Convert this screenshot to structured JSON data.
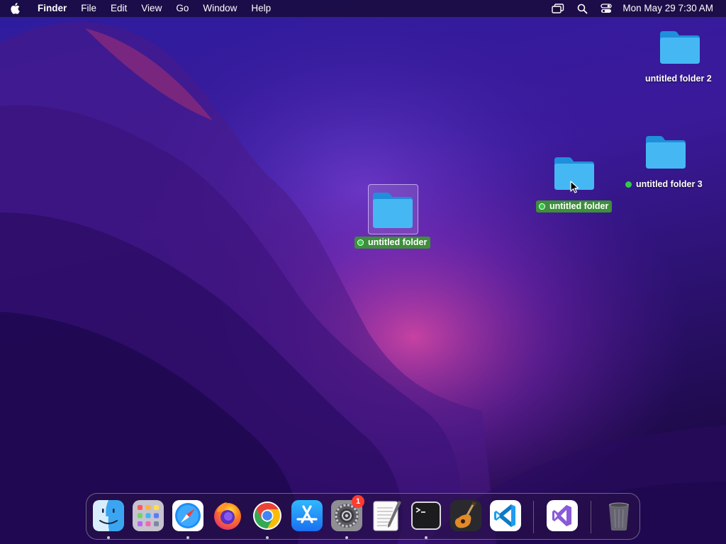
{
  "menubar": {
    "app_name": "Finder",
    "menus": [
      "File",
      "Edit",
      "View",
      "Go",
      "Window",
      "Help"
    ],
    "clock": "Mon May 29  7:30 AM",
    "status_icons": [
      "screen-mirroring-icon",
      "spotlight-search-icon",
      "control-center-icon"
    ]
  },
  "desktop": {
    "items": [
      {
        "name": "untitled folder 2",
        "tag": null,
        "selected": false
      },
      {
        "name": "untitled folder 3",
        "tag": "green",
        "selected": false
      },
      {
        "name": "untitled folder",
        "tag": "green",
        "selected": true
      },
      {
        "name": "untitled folder",
        "tag": "green",
        "selected": true
      }
    ]
  },
  "dock": {
    "apps": [
      {
        "name": "Finder",
        "running": true
      },
      {
        "name": "Launchpad",
        "running": false
      },
      {
        "name": "Safari",
        "running": true
      },
      {
        "name": "Firefox",
        "running": false
      },
      {
        "name": "Google Chrome",
        "running": true
      },
      {
        "name": "App Store",
        "running": false
      },
      {
        "name": "System Preferences",
        "running": true,
        "badge": "1"
      },
      {
        "name": "TextEdit",
        "running": false
      },
      {
        "name": "Terminal",
        "running": true
      },
      {
        "name": "GarageBand",
        "running": false
      },
      {
        "name": "Visual Studio Code",
        "running": false
      },
      {
        "name": "Visual Studio",
        "running": false
      },
      {
        "name": "Trash",
        "running": false
      }
    ]
  },
  "colors": {
    "folder": "#2ea8f0",
    "tag_green": "#33c94a",
    "selection_label": "#3d8f3a",
    "badge_red": "#ff3b30"
  }
}
